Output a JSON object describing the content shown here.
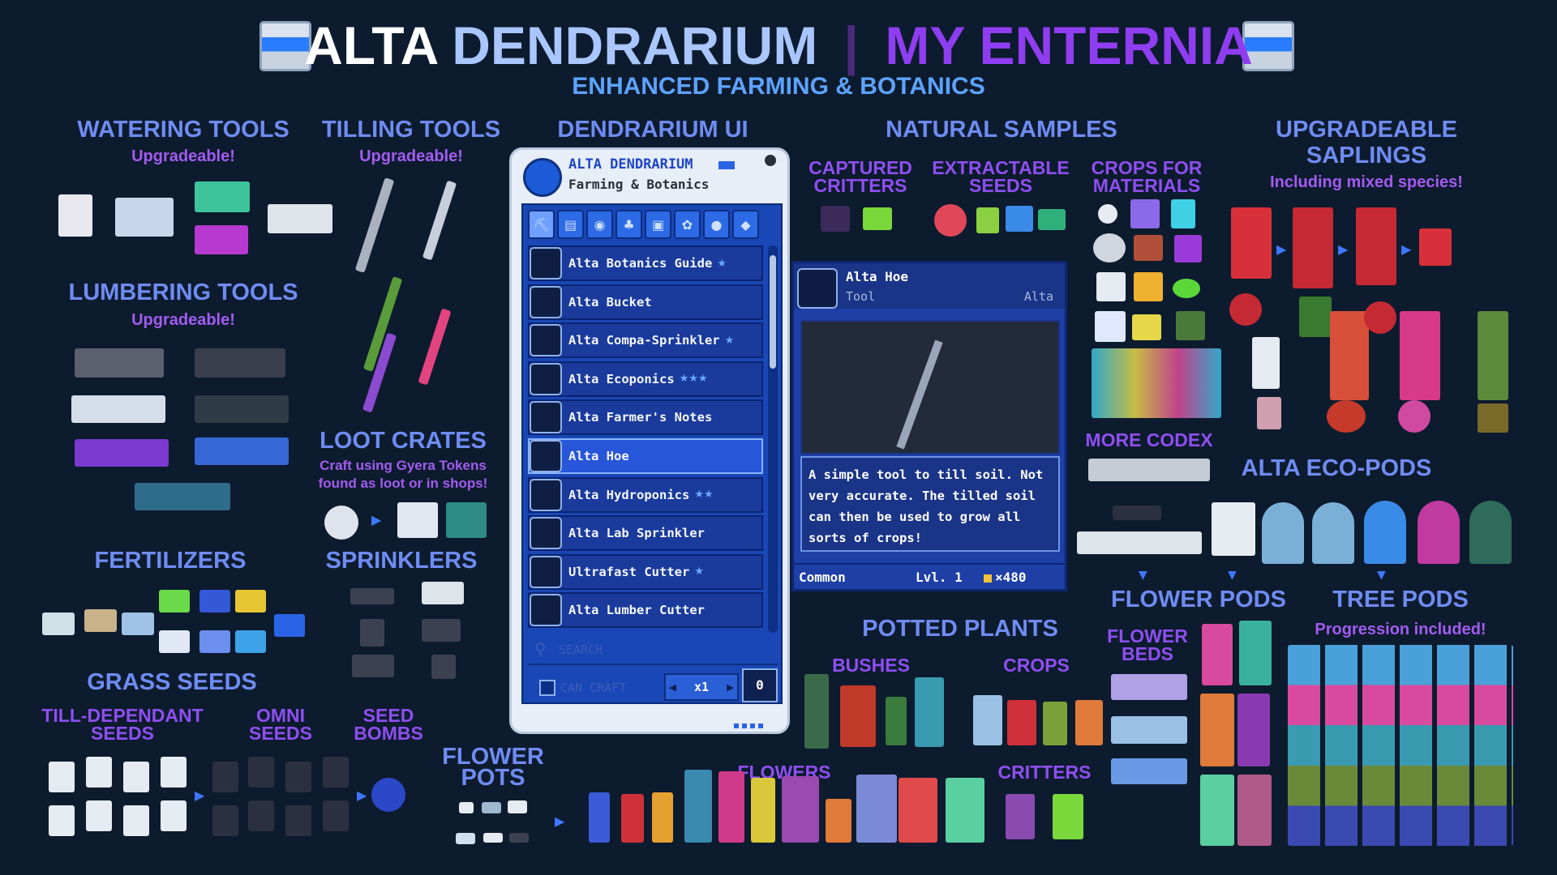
{
  "header": {
    "title_part1": "ALTA",
    "title_part2": "DENDRARIUM",
    "separator": "|",
    "title_part3": "MY ENTERNIA",
    "subtitle": "ENHANCED FARMING & BOTANICS"
  },
  "sections": {
    "watering_tools": {
      "title": "WATERING TOOLS",
      "note": "Upgradeable!"
    },
    "tilling_tools": {
      "title": "TILLING TOOLS",
      "note": "Upgradeable!"
    },
    "dendrarium_ui": {
      "title": "DENDRARIUM UI"
    },
    "natural_samples": {
      "title": "NATURAL SAMPLES"
    },
    "captured_critters": {
      "title_line1": "CAPTURED",
      "title_line2": "CRITTERS"
    },
    "extractable_seeds": {
      "title_line1": "EXTRACTABLE",
      "title_line2": "SEEDS"
    },
    "crops_for_materials": {
      "title_line1": "CROPS FOR",
      "title_line2": "MATERIALS"
    },
    "upgradeable_saplings": {
      "title_line1": "UPGRADEABLE",
      "title_line2": "SAPLINGS",
      "note": "Including mixed species!"
    },
    "lumbering_tools": {
      "title": "LUMBERING TOOLS",
      "note": "Upgradeable!"
    },
    "loot_crates": {
      "title": "LOOT CRATES",
      "note_line1": "Craft using Gyera Tokens",
      "note_line2": "found as loot or in shops!"
    },
    "more_codex": {
      "title": "MORE CODEX"
    },
    "alta_eco_pods": {
      "title": "ALTA ECO-PODS"
    },
    "fertilizers": {
      "title": "FERTILIZERS"
    },
    "sprinklers": {
      "title": "SPRINKLERS"
    },
    "grass_seeds": {
      "title": "GRASS SEEDS"
    },
    "till_dependant_seeds": {
      "title_line1": "TILL-DEPENDANT",
      "title_line2": "SEEDS"
    },
    "omni_seeds": {
      "title_line1": "OMNI",
      "title_line2": "SEEDS"
    },
    "seed_bombs": {
      "title_line1": "SEED",
      "title_line2": "BOMBS"
    },
    "flower_pots": {
      "title_line1": "FLOWER",
      "title_line2": "POTS"
    },
    "potted_plants": {
      "title": "POTTED PLANTS"
    },
    "bushes": {
      "title": "BUSHES"
    },
    "crops": {
      "title": "CROPS"
    },
    "flowers": {
      "title": "FLOWERS"
    },
    "critters": {
      "title": "CRITTERS"
    },
    "flower_pods": {
      "title": "FLOWER PODS"
    },
    "flower_beds": {
      "title_line1": "FLOWER",
      "title_line2": "BEDS"
    },
    "tree_pods": {
      "title": "TREE PODS",
      "note": "Progression included!"
    }
  },
  "codex": {
    "title": "ALTA DENDRARIUM",
    "subtitle": "Farming & Botanics",
    "tabs": [
      "pickaxe-tab-icon",
      "book-tab-icon",
      "pod-tab-icon",
      "plant-tab-icon",
      "bucket-tab-icon",
      "flower-tab-icon",
      "seed-tab-icon",
      "ore-tab-icon"
    ],
    "items": [
      {
        "label": "Alta Botanics Guide",
        "stars": "★"
      },
      {
        "label": "Alta Bucket",
        "stars": ""
      },
      {
        "label": "Alta Compa-Sprinkler",
        "stars": "★"
      },
      {
        "label": "Alta Ecoponics",
        "stars": "★★★"
      },
      {
        "label": "Alta Farmer's Notes",
        "stars": ""
      },
      {
        "label": "Alta Hoe",
        "stars": ""
      },
      {
        "label": "Alta Hydroponics",
        "stars": "★★"
      },
      {
        "label": "Alta Lab Sprinkler",
        "stars": ""
      },
      {
        "label": "Ultrafast Cutter",
        "stars": "★"
      },
      {
        "label": "Alta Lumber Cutter",
        "stars": ""
      }
    ],
    "selected_index": 5,
    "search_placeholder": "SEARCH",
    "can_craft_label": "CAN CRAFT",
    "quantity": "x1",
    "count": "0"
  },
  "tooltip": {
    "name": "Alta Hoe",
    "type": "Tool",
    "brand": "Alta",
    "description": "A simple tool to till soil. Not very accurate. The tilled soil can then be used to grow all sorts of crops!",
    "rarity": "Common",
    "level": "Lvl. 1",
    "price": "×480"
  },
  "colors": {
    "background": "#0d1b2e",
    "section_title": "#6f8cf2",
    "note_purple": "#a35cf0",
    "subtitle_blue": "#5da3ff",
    "panel_blue": "#1947b6"
  }
}
